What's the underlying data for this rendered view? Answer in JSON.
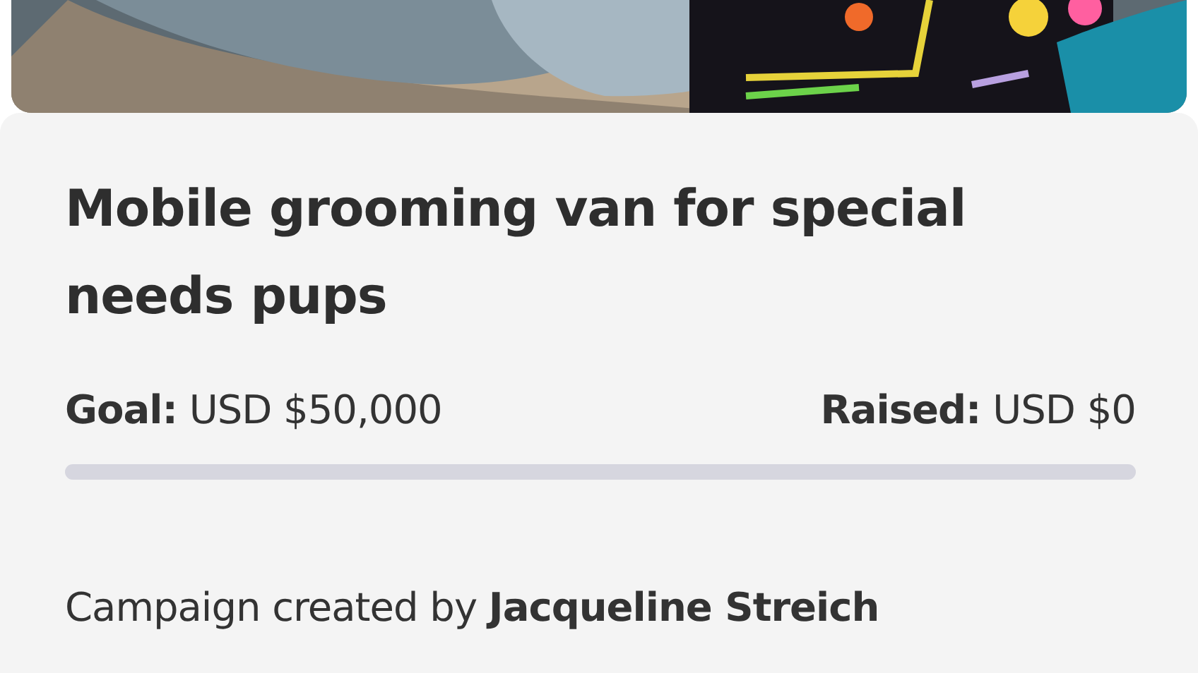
{
  "campaign": {
    "title": "Mobile grooming van for special needs pups",
    "goal": "**Goal:** USD $50,000",
    "raised": "**Raised:** USD $0",
    "progress": {
      "level": 0
    },
    "creator": "Campaign created by **Jacqueline Streich**"
  }
}
